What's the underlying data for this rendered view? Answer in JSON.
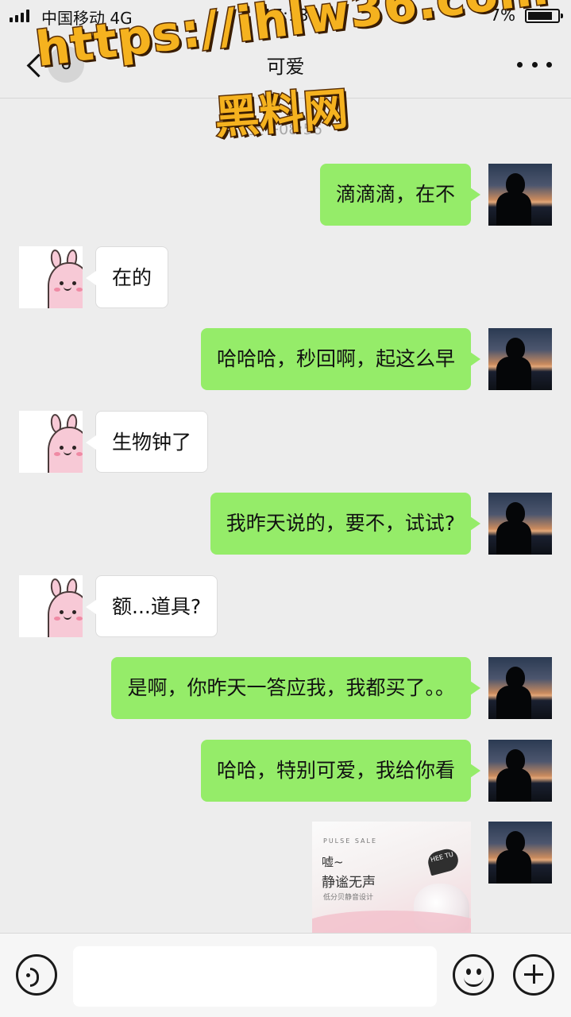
{
  "status_bar": {
    "carrier": "中国移动",
    "network": "4G",
    "time": "17:18",
    "battery_text": "7%"
  },
  "nav": {
    "unread_count": "6",
    "title": "可爱",
    "more_icon": "more-dots-icon",
    "back_icon": "chevron-left-icon"
  },
  "watermark": {
    "url": "https://ihlw36.com",
    "name": "黑料网"
  },
  "chat": {
    "time_divider": "上午08:56",
    "messages": [
      {
        "from": "me",
        "text": "滴滴滴，在不"
      },
      {
        "from": "other",
        "text": "在的"
      },
      {
        "from": "me",
        "text": "哈哈哈，秒回啊，起这么早"
      },
      {
        "from": "other",
        "text": "生物钟了"
      },
      {
        "from": "me",
        "text": "我昨天说的，要不，试试?"
      },
      {
        "from": "other",
        "text": "额...道具?"
      },
      {
        "from": "me",
        "text": "是啊，你昨天一答应我，我都买了。。"
      },
      {
        "from": "me",
        "text": "哈哈，特别可爱，我给你看"
      }
    ],
    "image_message": {
      "from": "me",
      "brand": "PULSE SALE",
      "line1": "嘘~",
      "line2": "静谧无声",
      "line3": "低分贝静音设计",
      "badge": "HEE TU"
    }
  },
  "input_bar": {
    "voice_icon": "voice-icon",
    "emoji_icon": "emoji-icon",
    "plus_icon": "plus-icon",
    "input_value": ""
  },
  "colors": {
    "background": "#ededed",
    "my_bubble": "#95ec69",
    "other_bubble": "#ffffff",
    "watermark_fill": "#f5b21f"
  }
}
